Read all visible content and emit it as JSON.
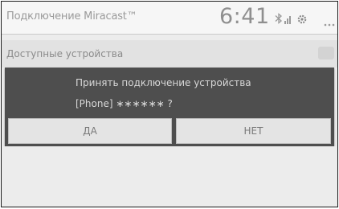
{
  "header": {
    "title": "Подключение Miracast™",
    "clock": "6:41",
    "icons": [
      "bluetooth-icon",
      "signal-icon",
      "gear-icon",
      "more-icon"
    ]
  },
  "section": {
    "label": "Доступные устройства"
  },
  "dialog": {
    "line1": "Принять подключение устройства",
    "line2": "[Phone] ∗∗∗∗∗∗ ?",
    "yes_label": "ДА",
    "no_label": "НЕТ"
  },
  "colors": {
    "dialog_bg": "#4e4e4e",
    "button_bg": "#e4e4e4",
    "screen_bg": "#ececec"
  }
}
